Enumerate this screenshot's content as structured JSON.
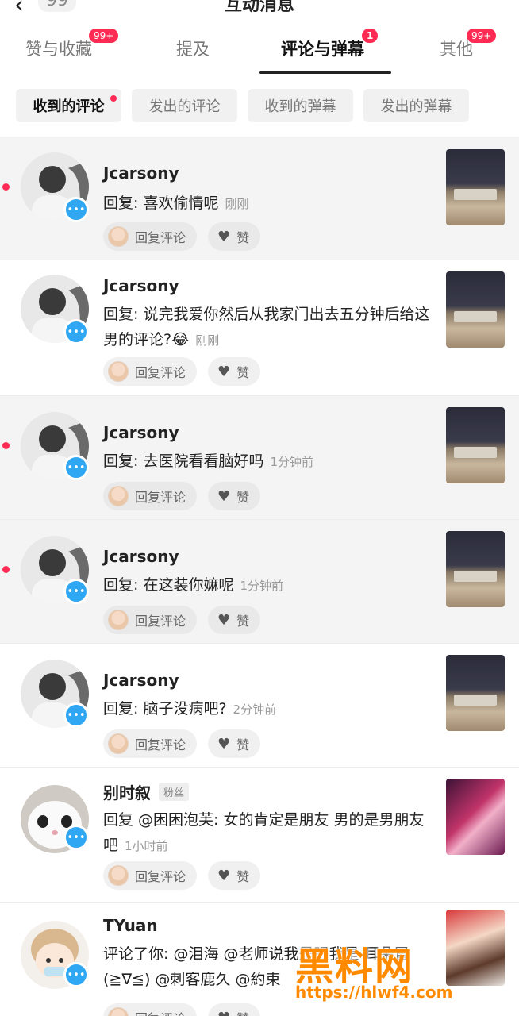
{
  "header": {
    "back_count": "99",
    "title": "互动消息"
  },
  "tabs": [
    {
      "label": "赞与收藏",
      "badge": "99+"
    },
    {
      "label": "提及",
      "badge": ""
    },
    {
      "label": "评论与弹幕",
      "badge": "1"
    },
    {
      "label": "其他",
      "badge": "99+"
    }
  ],
  "filters": [
    "收到的评论",
    "发出的评论",
    "收到的弹幕",
    "发出的弹幕"
  ],
  "item_actions": {
    "reply": "回复评论",
    "like": "赞"
  },
  "items": [
    {
      "name": "Jcarsony",
      "text": "回复: 喜欢偷情呢",
      "time": "刚刚",
      "unread": true
    },
    {
      "name": "Jcarsony",
      "text": "回复: 说完我爱你然后从我家门出去五分钟后给这男的评论?😂",
      "time": "刚刚",
      "unread": false
    },
    {
      "name": "Jcarsony",
      "text": "回复: 去医院看看脑好吗",
      "time": "1分钟前",
      "unread": true
    },
    {
      "name": "Jcarsony",
      "text": "回复: 在这装你嫲呢",
      "time": "1分钟前",
      "unread": true
    },
    {
      "name": "Jcarsony",
      "text": "回复: 脑子没病吧?",
      "time": "2分钟前",
      "unread": false
    },
    {
      "name": "别时叙",
      "tag": "粉丝",
      "text": "回复 @困困泡芙: 女的肯定是朋友 男的是男朋友吧",
      "time": "1小时前",
      "unread": false
    },
    {
      "name": "TYuan",
      "text": "评论了你: @泪海 @老师说我是眼我是 耳朵冒 (≧∇≦) @刺客鹿久 @約束",
      "time": "",
      "unread": false
    }
  ],
  "watermark": {
    "logo": "黑料网",
    "url": "https://hlwf4.com"
  }
}
